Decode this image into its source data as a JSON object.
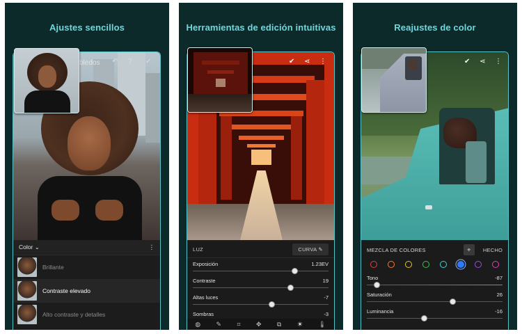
{
  "panels": [
    {
      "title": "Ajustes sencillos",
      "toolbar_partial_text": "bledos",
      "dropdown_label": "Color",
      "presets": [
        {
          "label": "Brillante",
          "state": "dim"
        },
        {
          "label": "Contraste elevado",
          "state": "active"
        },
        {
          "label": "Alto contraste y detalles",
          "state": "dim"
        }
      ]
    },
    {
      "title": "Herramientas de edición intuitivas",
      "section_label": "LUZ",
      "curve_button": "CURVA",
      "sliders": [
        {
          "label": "Exposición",
          "value": "1.23EV",
          "position": 0.75
        },
        {
          "label": "Contraste",
          "value": "19",
          "position": 0.72
        },
        {
          "label": "Altas luces",
          "value": "-7",
          "position": 0.58
        },
        {
          "label": "Sombras",
          "value": "-3",
          "position": 0.5
        }
      ],
      "tools": [
        "presets-icon",
        "brush-icon",
        "crop-icon",
        "healing-icon",
        "selective-icon",
        "light-icon",
        "temperature-icon"
      ]
    },
    {
      "title": "Reajustes de color",
      "section_label": "MEZCLA DE COLORES",
      "done_button": "HECHO",
      "swatches": [
        "#e04040",
        "#ff7a2a",
        "#e6c327",
        "#3fc04a",
        "#3fd6d6",
        "#2b7cff",
        "#9b4de0",
        "#e040b8"
      ],
      "selected_swatch": 5,
      "sliders": [
        {
          "label": "Tono",
          "value": "-87",
          "position": 0.07
        },
        {
          "label": "Saturación",
          "value": "26",
          "position": 0.63
        },
        {
          "label": "Luminancia",
          "value": "-16",
          "position": 0.42
        }
      ]
    }
  ]
}
